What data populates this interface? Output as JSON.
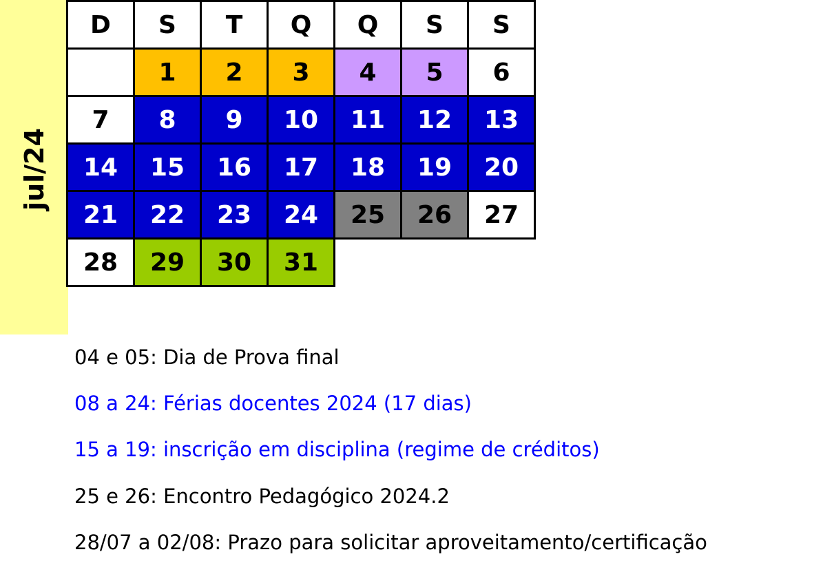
{
  "month": "jul/24",
  "weekdays": [
    "D",
    "S",
    "T",
    "Q",
    "Q",
    "S",
    "S"
  ],
  "colors": {
    "white": "#ffffff",
    "orange": "#ffc000",
    "lavender": "#cc99ff",
    "blue": "#0000cc",
    "gray": "#808080",
    "green": "#99cc00",
    "band": "#ffff99",
    "legend_black": "#000000",
    "legend_blue": "#0000ff"
  },
  "weeks": [
    [
      null,
      {
        "d": "1",
        "bg": "orange"
      },
      {
        "d": "2",
        "bg": "orange"
      },
      {
        "d": "3",
        "bg": "orange"
      },
      {
        "d": "4",
        "bg": "lavender"
      },
      {
        "d": "5",
        "bg": "lavender"
      },
      {
        "d": "6",
        "bg": "white"
      }
    ],
    [
      {
        "d": "7",
        "bg": "white"
      },
      {
        "d": "8",
        "bg": "blue"
      },
      {
        "d": "9",
        "bg": "blue"
      },
      {
        "d": "10",
        "bg": "blue"
      },
      {
        "d": "11",
        "bg": "blue"
      },
      {
        "d": "12",
        "bg": "blue"
      },
      {
        "d": "13",
        "bg": "blue"
      }
    ],
    [
      {
        "d": "14",
        "bg": "blue"
      },
      {
        "d": "15",
        "bg": "blue"
      },
      {
        "d": "16",
        "bg": "blue"
      },
      {
        "d": "17",
        "bg": "blue"
      },
      {
        "d": "18",
        "bg": "blue"
      },
      {
        "d": "19",
        "bg": "blue"
      },
      {
        "d": "20",
        "bg": "blue"
      }
    ],
    [
      {
        "d": "21",
        "bg": "blue"
      },
      {
        "d": "22",
        "bg": "blue"
      },
      {
        "d": "23",
        "bg": "blue"
      },
      {
        "d": "24",
        "bg": "blue"
      },
      {
        "d": "25",
        "bg": "gray"
      },
      {
        "d": "26",
        "bg": "gray"
      },
      {
        "d": "27",
        "bg": "white"
      }
    ],
    [
      {
        "d": "28",
        "bg": "white"
      },
      {
        "d": "29",
        "bg": "green"
      },
      {
        "d": "30",
        "bg": "green"
      },
      {
        "d": "31",
        "bg": "green"
      }
    ]
  ],
  "legend": [
    {
      "text": "04 e 05: Dia de Prova final",
      "color": "legend_black"
    },
    {
      "text": "08 a 24: Férias docentes 2024 (17 dias)",
      "color": "legend_blue"
    },
    {
      "text": "15 a 19: inscrição em disciplina (regime de créditos)",
      "color": "legend_blue"
    },
    {
      "text": "25 e 26: Encontro Pedagógico 2024.2",
      "color": "legend_black"
    },
    {
      "text": "28/07 a 02/08: Prazo para solicitar aproveitamento/certificação",
      "color": "legend_black"
    }
  ]
}
